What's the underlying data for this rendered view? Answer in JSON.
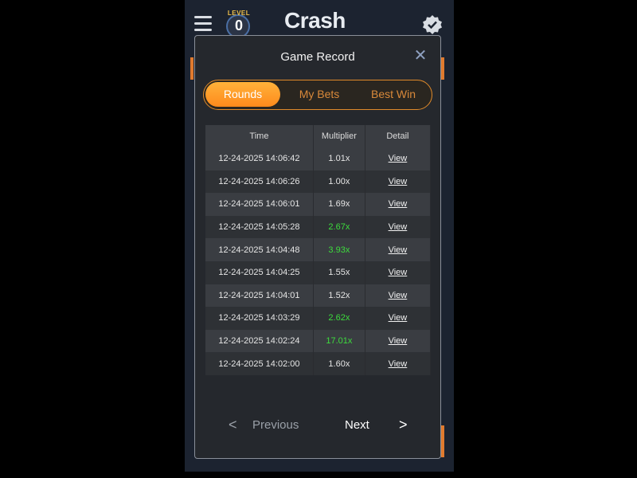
{
  "header": {
    "level_label": "LEVEL",
    "level_value": "0",
    "brand": "Crash"
  },
  "modal": {
    "title": "Game Record",
    "close_icon": "close-icon",
    "tabs": [
      {
        "label": "Rounds",
        "active": true
      },
      {
        "label": "My Bets",
        "active": false
      },
      {
        "label": "Best Win",
        "active": false
      }
    ],
    "table": {
      "headers": [
        "Time",
        "Multiplier",
        "Detail"
      ],
      "rows": [
        {
          "time": "12-24-2025 14:06:42",
          "multiplier": "1.01x",
          "detail": "View",
          "highlight": false
        },
        {
          "time": "12-24-2025 14:06:26",
          "multiplier": "1.00x",
          "detail": "View",
          "highlight": false
        },
        {
          "time": "12-24-2025 14:06:01",
          "multiplier": "1.69x",
          "detail": "View",
          "highlight": false
        },
        {
          "time": "12-24-2025 14:05:28",
          "multiplier": "2.67x",
          "detail": "View",
          "highlight": true
        },
        {
          "time": "12-24-2025 14:04:48",
          "multiplier": "3.93x",
          "detail": "View",
          "highlight": true
        },
        {
          "time": "12-24-2025 14:04:25",
          "multiplier": "1.55x",
          "detail": "View",
          "highlight": false
        },
        {
          "time": "12-24-2025 14:04:01",
          "multiplier": "1.52x",
          "detail": "View",
          "highlight": false
        },
        {
          "time": "12-24-2025 14:03:29",
          "multiplier": "2.62x",
          "detail": "View",
          "highlight": true
        },
        {
          "time": "12-24-2025 14:02:24",
          "multiplier": "17.01x",
          "detail": "View",
          "highlight": true
        },
        {
          "time": "12-24-2025 14:02:00",
          "multiplier": "1.60x",
          "detail": "View",
          "highlight": false
        }
      ]
    },
    "pager": {
      "prev_label": "Previous",
      "next_label": "Next",
      "prev_arrow": "<",
      "next_arrow": ">"
    }
  },
  "colors": {
    "accent": "#ff8a1c",
    "highlight_multiplier": "#3ddc3d",
    "modal_bg": "#25282d"
  }
}
